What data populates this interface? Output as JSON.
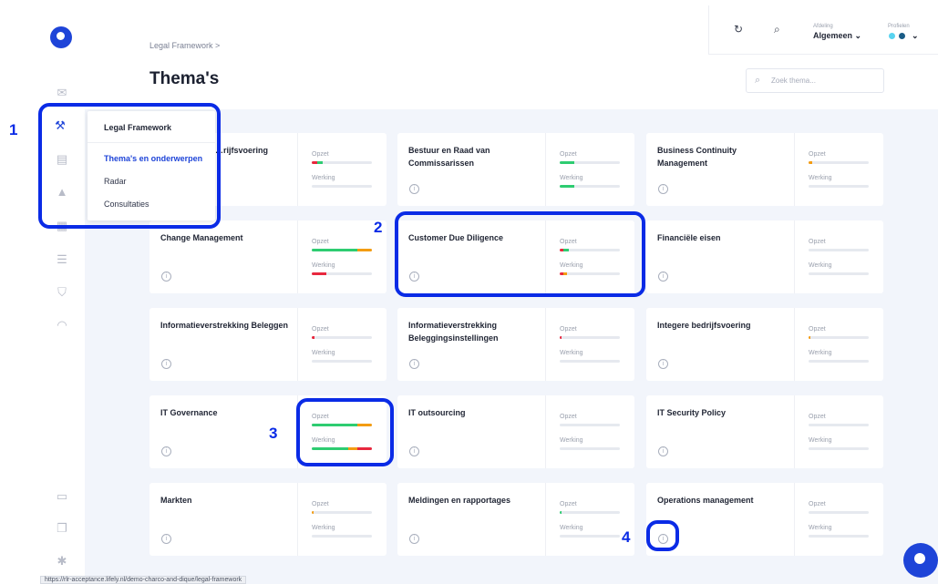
{
  "breadcrumb": {
    "label": "Legal Framework",
    "sep": ">"
  },
  "page_title": "Thema's",
  "search": {
    "placeholder": "Zoek thema...",
    "icon": "search-icon"
  },
  "topbar": {
    "refresh_icon": "refresh-icon",
    "search_icon": "search-icon",
    "afdeling_label": "Afdeling",
    "afdeling_value": "Algemeen",
    "profielen_label": "Profielen"
  },
  "menu": {
    "heading": "Legal Framework",
    "items": [
      {
        "label": "Thema's en onderwerpen",
        "active": true
      },
      {
        "label": "Radar",
        "active": false
      },
      {
        "label": "Consultaties",
        "active": false
      }
    ]
  },
  "labels": {
    "opzet": "Opzet",
    "werking": "Werking",
    "info": "i"
  },
  "cards": [
    {
      "title": "Integere bedrijfsvoering",
      "title_visible": "…rijfsvoering"
    },
    {
      "title": "Bestuur en Raad van Commissarissen"
    },
    {
      "title": "Business Continuity Management"
    },
    {
      "title": "Change Management"
    },
    {
      "title": "Customer Due Diligence"
    },
    {
      "title": "Financiële eisen"
    },
    {
      "title": "Informatieverstrekking Beleggen"
    },
    {
      "title": "Informatieverstrekking Beleggingsinstellingen"
    },
    {
      "title": "Integere bedrijfsvoering"
    },
    {
      "title": "IT Governance"
    },
    {
      "title": "IT outsourcing"
    },
    {
      "title": "IT Security Policy"
    },
    {
      "title": "Markten"
    },
    {
      "title": "Meldingen en rapportages"
    },
    {
      "title": "Operations management"
    }
  ],
  "annotations": [
    "1",
    "2",
    "3",
    "4"
  ],
  "status_url": "https://rlr-acceptance.lifely.nl/demo-charco-and-dique/legal-framework",
  "colors": {
    "accent": "#1e44d8",
    "green": "#2ecc71",
    "orange": "#f39c12",
    "red": "#e8283e",
    "annotation": "#0a2be6"
  }
}
